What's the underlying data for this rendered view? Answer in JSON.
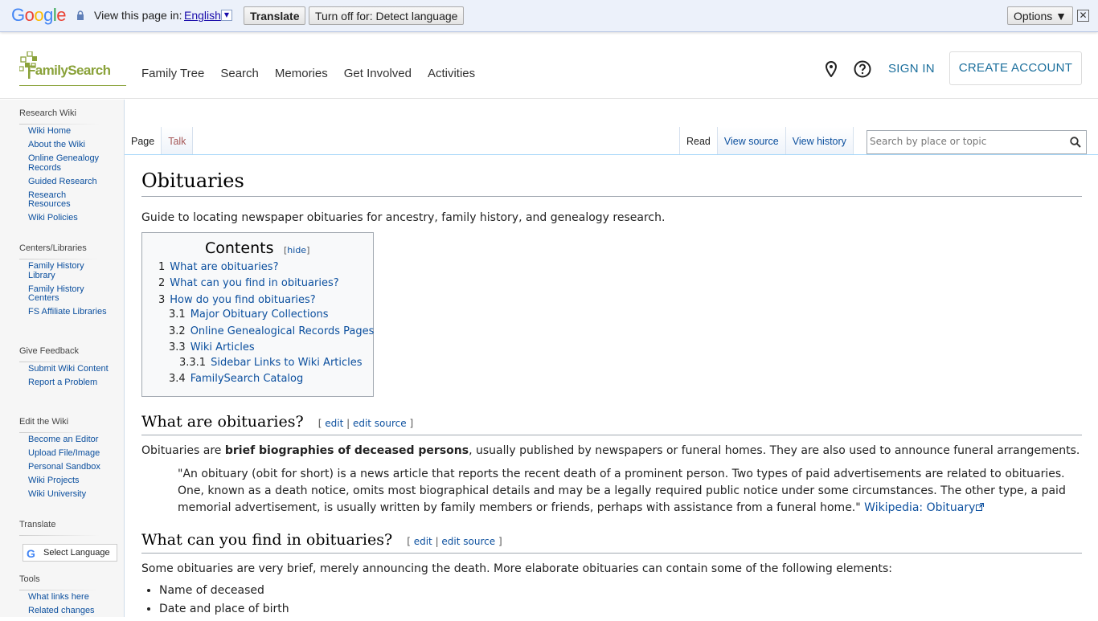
{
  "translate_bar": {
    "logo_text": "Google",
    "view_label": "View this page in:",
    "language": "English",
    "translate_label": "Translate",
    "turn_off_label": "Turn off for: Detect language",
    "options_label": "Options ▼",
    "close_glyph": "✕"
  },
  "header": {
    "logo_text": "FamilySearch",
    "nav": [
      "Family Tree",
      "Search",
      "Memories",
      "Get Involved",
      "Activities"
    ],
    "sign_in": "SIGN IN",
    "create_account": "CREATE ACCOUNT"
  },
  "sidebar": {
    "sections": [
      {
        "title": "Research Wiki",
        "items": [
          "Wiki Home",
          "About the Wiki",
          "Online Genealogy Records",
          "Guided Research",
          "Research Resources",
          "Wiki Policies"
        ]
      },
      {
        "title": "Centers/Libraries",
        "items": [
          "Family History Library",
          "Family History Centers",
          "FS Affiliate Libraries"
        ]
      },
      {
        "title": "Give Feedback",
        "items": [
          "Submit Wiki Content",
          "Report a Problem"
        ]
      },
      {
        "title": "Edit the Wiki",
        "items": [
          "Become an Editor",
          "Upload File/Image",
          "Personal Sandbox",
          "Wiki Projects",
          "Wiki University"
        ]
      },
      {
        "title": "Translate",
        "items": []
      },
      {
        "title": "Tools",
        "items": [
          "What links here",
          "Related changes"
        ]
      }
    ],
    "select_language": "Select Language",
    "google_g": "G"
  },
  "tabs": {
    "page": "Page",
    "talk": "Talk",
    "read": "Read",
    "view_source": "View source",
    "view_history": "View history"
  },
  "search": {
    "placeholder": "Search by place or topic"
  },
  "article": {
    "title": "Obituaries",
    "intro": "Guide to locating newspaper obituaries for ancestry, family history, and genealogy research.",
    "toc": {
      "title": "Contents",
      "hide": "hide",
      "items": [
        {
          "num": "1",
          "text": "What are obituaries?"
        },
        {
          "num": "2",
          "text": "What can you find in obituaries?"
        },
        {
          "num": "3",
          "text": "How do you find obituaries?"
        },
        {
          "num": "3.1",
          "text": "Major Obituary Collections"
        },
        {
          "num": "3.2",
          "text": "Online Genealogical Records Pages"
        },
        {
          "num": "3.3",
          "text": "Wiki Articles"
        },
        {
          "num": "3.3.1",
          "text": "Sidebar Links to Wiki Articles"
        },
        {
          "num": "3.4",
          "text": "FamilySearch Catalog"
        }
      ]
    },
    "edit_label": "edit",
    "edit_source_label": "edit source",
    "section1": {
      "heading": "What are obituaries?",
      "para_pre": "Obituaries are ",
      "para_bold": "brief biographies of deceased persons",
      "para_post": ", usually published by newspapers or funeral homes. They are also used to announce funeral arrangements.",
      "quote": "\"An obituary (obit for short) is a news article that reports the recent death of a prominent person. Two types of paid advertisements are related to obituaries. One, known as a death notice, omits most biographical details and may be a legally required public notice under some circumstances. The other type, a paid memorial advertisement, is usually written by family members or friends, perhaps with assistance from a funeral home.\"",
      "quote_link": "Wikipedia: Obituary"
    },
    "section2": {
      "heading": "What can you find in obituaries?",
      "para": "Some obituaries are very brief, merely announcing the death. More elaborate obituaries can contain some of the following elements:",
      "list": [
        "Name of deceased",
        "Date and place of birth"
      ]
    }
  }
}
